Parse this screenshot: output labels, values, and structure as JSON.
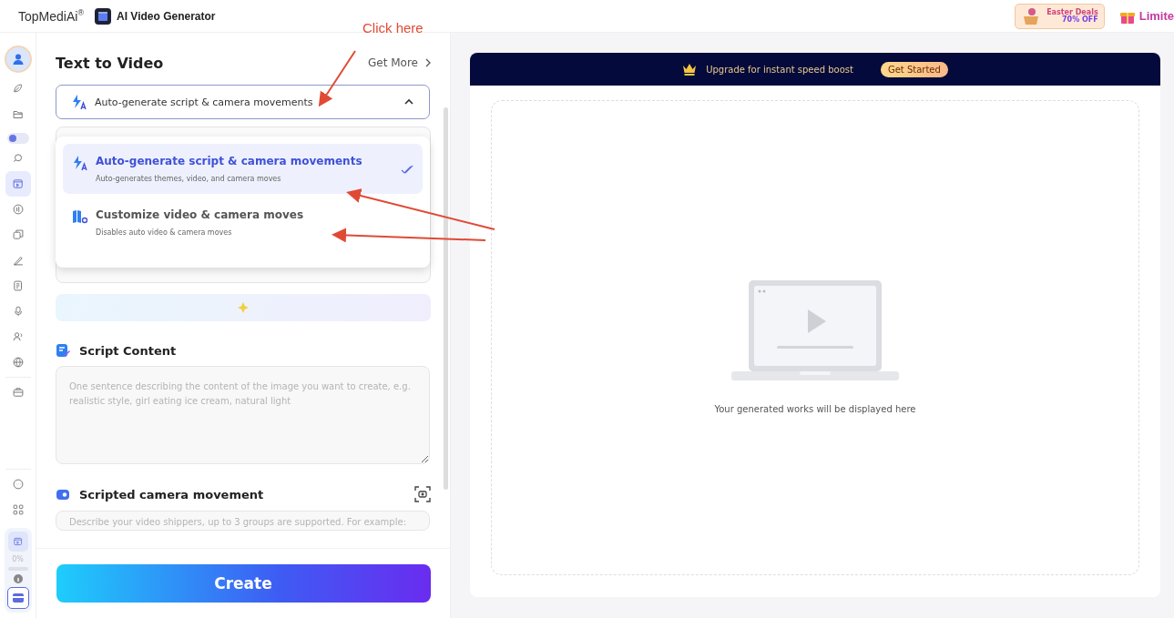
{
  "header": {
    "brand": "TopMediAi$^{®}$",
    "app_title": "AI Video Generator",
    "promo": {
      "title": "Easter Deals",
      "discount": "70% OFF"
    },
    "limited": "Limite"
  },
  "sidebar": {
    "items": [
      {
        "kind": "avatar",
        "selected": false
      },
      {
        "kind": "icon",
        "selected": false
      },
      {
        "kind": "icon",
        "selected": false
      },
      {
        "kind": "toggle",
        "selected": false
      },
      {
        "kind": "icon",
        "selected": false
      },
      {
        "kind": "icon",
        "selected": true
      },
      {
        "kind": "icon",
        "selected": false
      },
      {
        "kind": "icon",
        "selected": false
      },
      {
        "kind": "icon",
        "selected": false
      },
      {
        "kind": "icon",
        "selected": false
      },
      {
        "kind": "icon",
        "selected": false
      },
      {
        "kind": "icon",
        "selected": false
      },
      {
        "kind": "icon",
        "selected": false
      },
      {
        "kind": "icon",
        "selected": false
      }
    ],
    "bottom_items": [
      {
        "kind": "icon",
        "selected": false
      },
      {
        "kind": "icon",
        "selected": false
      }
    ],
    "usage": {
      "reading": "0%",
      "level": 0
    }
  },
  "panel": {
    "title": "Text to Video",
    "get_more": "Get More",
    "mode_select": {
      "value": "Auto-generate script & camera movements",
      "expanded": true,
      "options": [
        {
          "title": "Auto-generate script & camera movements",
          "description": "Auto-generates themes, video, and camera moves",
          "selected": true
        },
        {
          "title": "Customize video & camera moves",
          "description": "Disables auto video & camera moves",
          "selected": false
        }
      ]
    },
    "script_content": {
      "title": "Script Content",
      "placeholder": "One sentence describing the content of the image you want to create, e.g. realistic style, girl eating ice cream, natural light"
    },
    "camera_movement": {
      "title": "Scripted camera movement",
      "placeholder": "Describe your video shippers, up to 3 groups are supported. For example:"
    },
    "create": "Create"
  },
  "preview": {
    "banner": {
      "text": "Upgrade for instant speed boost",
      "button": "Get Started"
    },
    "empty_text": "Your generated works will be displayed here"
  },
  "annotation": {
    "label": "Click here"
  }
}
